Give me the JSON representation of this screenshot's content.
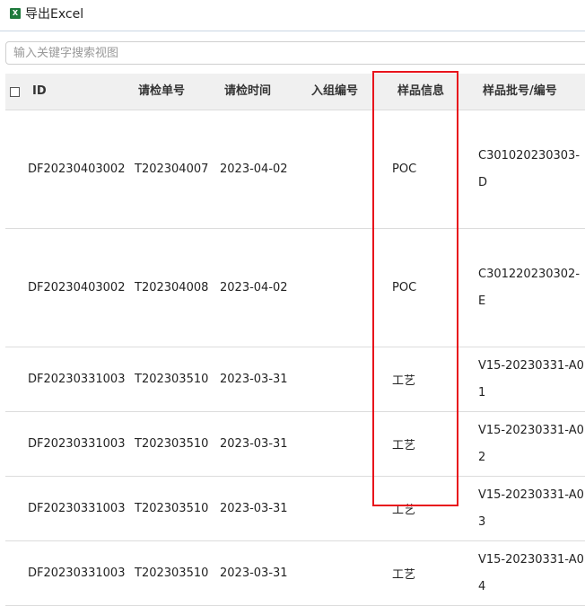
{
  "toolbar": {
    "export_label": "导出Excel",
    "export_icon_letter": "X",
    "excel_color": "#1e7a3c"
  },
  "search": {
    "placeholder": "输入关键字搜索视图",
    "value": ""
  },
  "table": {
    "columns": [
      "ID",
      "请检单号",
      "请检时间",
      "入组编号",
      "样品信息",
      "样品批号/编号"
    ],
    "rows": [
      {
        "id": "DF20230403002",
        "req_no": "T202304007",
        "req_time": "2023-04-02",
        "group_no": "",
        "sample_info": "POC",
        "batch_no": "C301020230303-D"
      },
      {
        "id": "DF20230403002",
        "req_no": "T202304008",
        "req_time": "2023-04-02",
        "group_no": "",
        "sample_info": "POC",
        "batch_no": "C301220230302-E"
      },
      {
        "id": "DF20230331003",
        "req_no": "T202303510",
        "req_time": "2023-03-31",
        "group_no": "",
        "sample_info": "工艺",
        "batch_no": "V15-20230331-A01"
      },
      {
        "id": "DF20230331003",
        "req_no": "T202303510",
        "req_time": "2023-03-31",
        "group_no": "",
        "sample_info": "工艺",
        "batch_no": "V15-20230331-A02"
      },
      {
        "id": "DF20230331003",
        "req_no": "T202303510",
        "req_time": "2023-03-31",
        "group_no": "",
        "sample_info": "工艺",
        "batch_no": "V15-20230331-A03"
      },
      {
        "id": "DF20230331003",
        "req_no": "T202303510",
        "req_time": "2023-03-31",
        "group_no": "",
        "sample_info": "工艺",
        "batch_no": "V15-20230331-A04"
      }
    ]
  },
  "highlight_color": "#e8141c"
}
